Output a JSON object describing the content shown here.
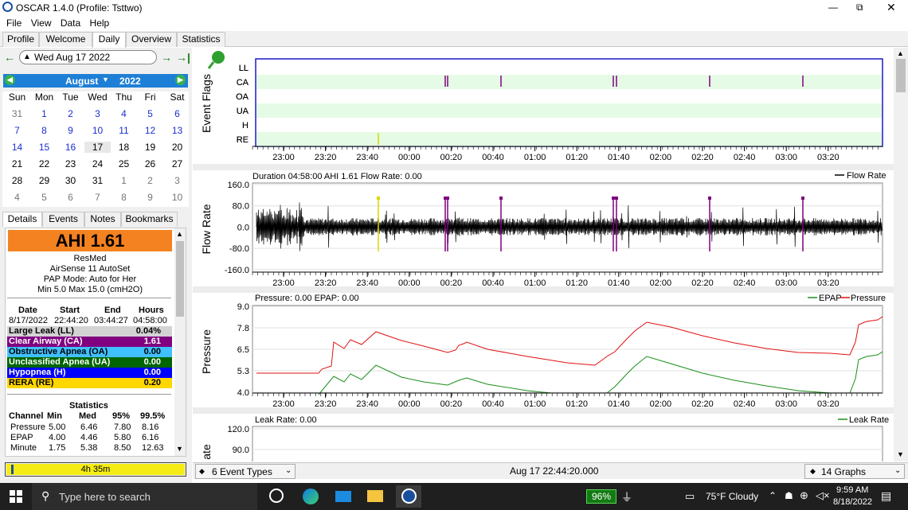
{
  "window": {
    "title": "OSCAR 1.4.0 (Profile: Tsttwo)",
    "controls": [
      "—",
      "⧉",
      "✕"
    ]
  },
  "menu": [
    "File",
    "View",
    "Data",
    "Help"
  ],
  "tabs": [
    "Profile",
    "Welcome",
    "Daily",
    "Overview",
    "Statistics"
  ],
  "selected_tab": "Daily",
  "date_nav": {
    "date": "Wed Aug 17 2022"
  },
  "calendar": {
    "month": "August",
    "year": "2022",
    "weekdays": [
      "Sun",
      "Mon",
      "Tue",
      "Wed",
      "Thu",
      "Fri",
      "Sat"
    ],
    "weeks": [
      [
        "31",
        "1",
        "2",
        "3",
        "4",
        "5",
        "6"
      ],
      [
        "7",
        "8",
        "9",
        "10",
        "11",
        "12",
        "13"
      ],
      [
        "14",
        "15",
        "16",
        "17",
        "18",
        "19",
        "20"
      ],
      [
        "21",
        "22",
        "23",
        "24",
        "25",
        "26",
        "27"
      ],
      [
        "28",
        "29",
        "30",
        "31",
        "1",
        "2",
        "3"
      ],
      [
        "4",
        "5",
        "6",
        "7",
        "8",
        "9",
        "10"
      ]
    ]
  },
  "detail_tabs": [
    "Details",
    "Events",
    "Notes",
    "Bookmarks"
  ],
  "details": {
    "ahi": "AHI 1.61",
    "machine": "ResMed",
    "model": "AirSense 11 AutoSet",
    "mode": "PAP Mode: Auto for Her",
    "range": "Min 5.0 Max 15.0 (cmH2O)",
    "session_headers": [
      "Date",
      "Start",
      "End",
      "Hours"
    ],
    "session": [
      "8/17/2022",
      "22:44:20",
      "03:44:27",
      "04:58:00"
    ],
    "events": [
      {
        "name": "Large Leak (LL)",
        "value": "0.04%",
        "color": "#d3d3d3",
        "text": "#000"
      },
      {
        "name": "Clear Airway (CA)",
        "value": "1.61",
        "color": "#800080",
        "text": "#fff"
      },
      {
        "name": "Obstructive Apnea (OA)",
        "value": "0.00",
        "color": "#40c0ff",
        "text": "#000"
      },
      {
        "name": "Unclassified Apnea (UA)",
        "value": "0.00",
        "color": "#006400",
        "text": "#fff"
      },
      {
        "name": "Hypopnea (H)",
        "value": "0.00",
        "color": "#0000ff",
        "text": "#fff"
      },
      {
        "name": "RERA (RE)",
        "value": "0.20",
        "color": "#ffd700",
        "text": "#000"
      }
    ],
    "stats_title": "Statistics",
    "stats_headers": [
      "Channel",
      "Min",
      "Med",
      "95%",
      "99.5%"
    ],
    "stats": [
      [
        "Pressure",
        "5.00",
        "6.46",
        "7.80",
        "8.16"
      ],
      [
        "EPAP",
        "4.00",
        "4.46",
        "5.80",
        "6.16"
      ],
      [
        "Minute",
        "1.75",
        "5.38",
        "8.50",
        "12.63"
      ]
    ]
  },
  "usage": "4h 35m",
  "graphs": {
    "event_flags": {
      "label": "Event Flags",
      "rows": [
        "LL",
        "CA",
        "OA",
        "UA",
        "H",
        "RE"
      ]
    },
    "x_ticks": [
      "23:00",
      "23:20",
      "23:40",
      "00:00",
      "00:20",
      "00:40",
      "01:00",
      "01:20",
      "01:40",
      "02:00",
      "02:20",
      "02:40",
      "03:00",
      "03:20"
    ],
    "flow": {
      "label": "Flow Rate",
      "header": "Duration 04:58:00 AHI 1.61 Flow Rate: 0.00",
      "legend": "Flow Rate",
      "y_ticks": [
        "160.0",
        "80.0",
        "0.0",
        "-80.0",
        "-160.0"
      ]
    },
    "pressure": {
      "label": "Pressure",
      "header": "Pressure: 0.00 EPAP: 0.00",
      "legend_epap": "EPAP",
      "legend_pressure": "Pressure",
      "y_ticks": [
        "9.0",
        "7.8",
        "6.5",
        "5.3",
        "4.0"
      ]
    },
    "leak": {
      "label": "Leak Rate",
      "visible_label": "ate",
      "header": "Leak Rate: 0.00",
      "legend": "Leak Rate",
      "y_ticks": [
        "120.0",
        "90.0"
      ]
    }
  },
  "bottom": {
    "event_types": "6 Event Types",
    "timestamp": "Aug 17 22:44:20.000",
    "graphs": "14 Graphs"
  },
  "taskbar": {
    "search": "Type here to search",
    "battery": "96%",
    "weather": "75°F  Cloudy",
    "time": "9:59 AM",
    "date": "8/18/2022"
  }
}
